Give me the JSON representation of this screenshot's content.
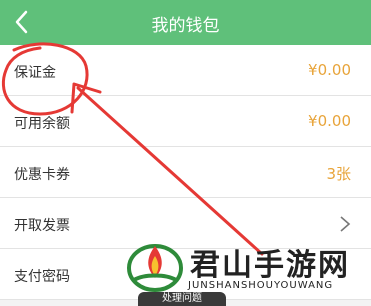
{
  "header": {
    "title": "我的钱包",
    "back_icon": "back-arrow-icon"
  },
  "rows": [
    {
      "label": "保证金",
      "value": "¥0.00"
    },
    {
      "label": "可用余额",
      "value": "¥0.00"
    },
    {
      "label": "优惠卡券",
      "value": "3张"
    },
    {
      "label": "开取发票",
      "value": ""
    },
    {
      "label": "支付密码",
      "value": ""
    }
  ],
  "watermark": {
    "name": "君山手游网",
    "sub": "JUNSHANSHOUYOUWANG"
  },
  "bottom_tab": {
    "label": "处理问题"
  },
  "colors": {
    "header": "#5fc07a",
    "value": "#e8a43a",
    "annotation": "#e53935"
  }
}
